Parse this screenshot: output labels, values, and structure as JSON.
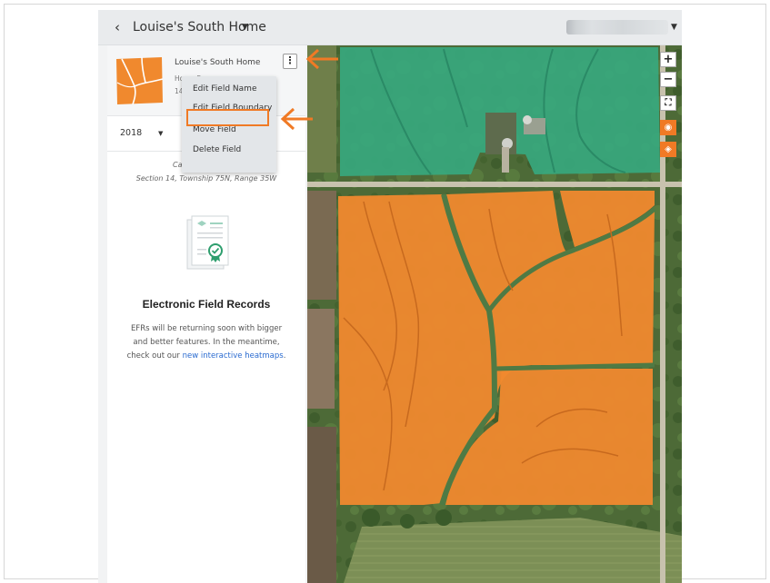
{
  "topbar": {
    "back_glyph": "‹",
    "field_title": "Louise's South Home",
    "title_caret": "▼",
    "account_caret": "▼"
  },
  "panel": {
    "field_name": "Louise's South Home",
    "farm_name": "Home Farm",
    "acres": "14",
    "kebab_glyph": "⋮",
    "year": "2018",
    "year_caret": "▼",
    "location_line1": "Ca",
    "location_line2": "Section 14, Township 75N, Range 35W",
    "efr_title": "Electronic Field Records",
    "efr_body": "EFRs will be returning soon with bigger and better features. In the meantime, check out our",
    "efr_link": "new interactive heatmaps",
    "efr_body_end": "."
  },
  "menu": {
    "items": [
      "Edit Field Name",
      "Edit Field Boundary",
      "Move Field",
      "Delete Field"
    ]
  },
  "map_controls": {
    "zoom_in": "+",
    "zoom_out": "−",
    "fullscreen": "⛶",
    "globe": "◉",
    "layers": "◈"
  },
  "colors": {
    "accent_orange": "#f07a25",
    "field_orange": "#f0892e",
    "field_green": "#37a87e"
  }
}
